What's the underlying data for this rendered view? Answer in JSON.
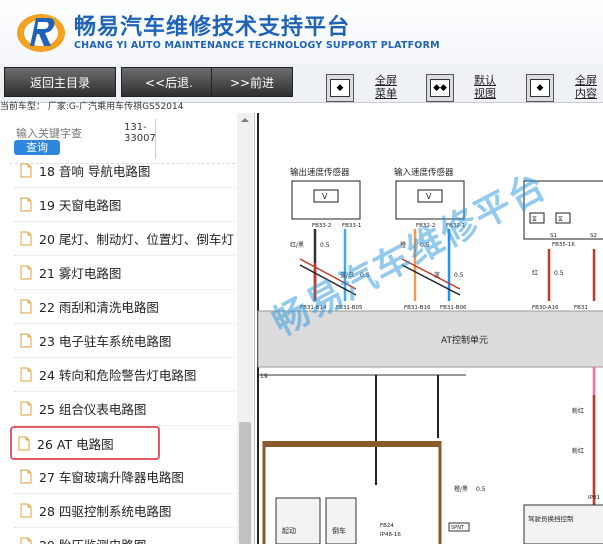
{
  "header": {
    "title_cn": "畅易汽车维修技术支持平台",
    "title_en": "CHANG YI AUTO MAINTENANCE TECHNOLOGY SUPPORT PLATFORM"
  },
  "toolbar": {
    "back_main": "返回主目录",
    "prev": "<<后退.",
    "next": ">>前进",
    "fullscreen_menu": [
      "全屏",
      "菜单"
    ],
    "default_view": [
      "默认",
      "视图"
    ],
    "fullscreen_content": [
      "全屏",
      "内容"
    ]
  },
  "car_info": "当前车型： 厂家:G-广汽乘用车传祺GS52014",
  "sidebar": {
    "search_placeholder": "输入关键字查",
    "search_button": "查询",
    "code": [
      "131-",
      "33007"
    ],
    "items": [
      {
        "label": "18 音响 导航电路图"
      },
      {
        "label": "19 天窗电路图"
      },
      {
        "label": "20 尾灯、制动灯、位置灯、倒车灯"
      },
      {
        "label": "21 雾灯电路图"
      },
      {
        "label": "22 雨刮和清洗电路图"
      },
      {
        "label": "23 电子驻车系统电路图"
      },
      {
        "label": "24 转向和危险警告灯电路图"
      },
      {
        "label": "25 组合仪表电路图"
      },
      {
        "label": "26 AT 电路图"
      },
      {
        "label": "27 车窗玻璃升降器电路图"
      },
      {
        "label": "28 四驱控制系统电路图"
      },
      {
        "label": "29 胎压监测电路图"
      }
    ]
  },
  "diagram": {
    "sensor_out": "输出速度传感器",
    "sensor_in": "输入速度传感器",
    "at_unit": "AT控制单元",
    "pins": {
      "fb33_2": "FB33-2",
      "fb33_1": "FB33-1",
      "fb32_2": "FB32-2",
      "fb32_1": "FB32-1",
      "fb35_16": "FB35-16",
      "s1": "S1",
      "s2": "S2",
      "fb31_b14": "FB31-B14",
      "fb31_b05": "FB31-B05",
      "fb31_b16": "FB31-B16",
      "fb31_b06": "FB31-B06",
      "fb30_a16": "FB30-A16",
      "fb31": "FB31",
      "fb24": "FB24",
      "ip48_16": "IP48-16",
      "ip01": "IP01",
      "left_19": "19",
      "spnt": "SPNT"
    },
    "wires": {
      "red_black": "红/黑",
      "blue_white": "蓝/白",
      "orange": "橙",
      "blue": "蓝",
      "red": "红",
      "pink_red": "粉红",
      "orange_black": "橙/黑",
      "size": "0.5"
    },
    "blocks": {
      "motor": "起动",
      "reverse": "倒车",
      "driver_switch": "驾驶员换挡控制"
    }
  },
  "watermark": "畅易汽车维修平台"
}
